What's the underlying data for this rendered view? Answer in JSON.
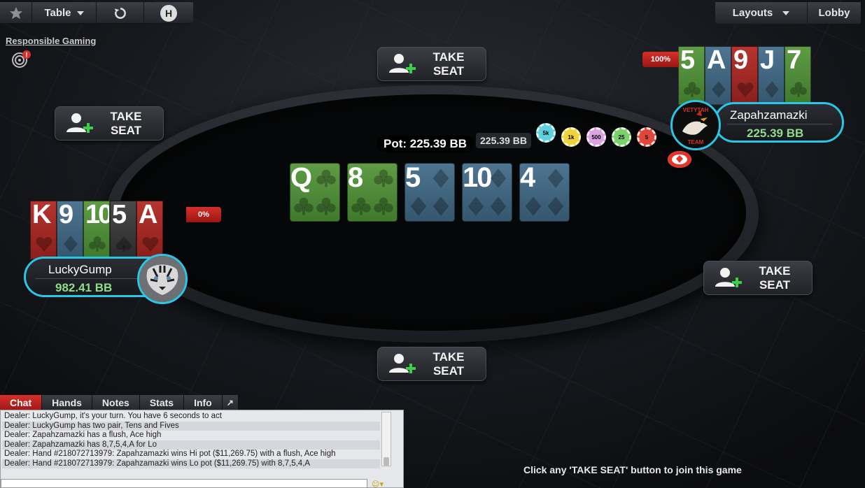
{
  "toolbar": {
    "table_label": "Table",
    "h_label": "H",
    "layouts_label": "Layouts",
    "lobby_label": "Lobby"
  },
  "responsible_gaming": "Responsible Gaming",
  "take_seat_label": "TAKE\nSEAT",
  "pot": "Pot: 225.39 BB",
  "bet_amount": "225.39 BB",
  "chips": [
    "5k",
    "1k",
    "500",
    "25",
    "5"
  ],
  "board": [
    {
      "rank": "Q",
      "suit": "clubs"
    },
    {
      "rank": "8",
      "suit": "clubs"
    },
    {
      "rank": "5",
      "suit": "diamonds"
    },
    {
      "rank": "10",
      "suit": "diamonds"
    },
    {
      "rank": "4",
      "suit": "diamonds"
    }
  ],
  "players": {
    "right": {
      "name": "Zapahzamazki",
      "stack": "225.39 BB",
      "percent": "100%",
      "avatar_text": "VETYTAH TEAM",
      "cards": [
        {
          "rank": "5",
          "suit": "clubs"
        },
        {
          "rank": "A",
          "suit": "diamonds"
        },
        {
          "rank": "9",
          "suit": "hearts"
        },
        {
          "rank": "J",
          "suit": "diamonds"
        },
        {
          "rank": "7",
          "suit": "clubs"
        }
      ]
    },
    "left": {
      "name": "LuckyGump",
      "stack": "982.41 BB",
      "percent": "0%",
      "cards": [
        {
          "rank": "K",
          "suit": "hearts"
        },
        {
          "rank": "9",
          "suit": "diamonds"
        },
        {
          "rank": "10",
          "suit": "clubs"
        },
        {
          "rank": "5",
          "suit": "spades"
        },
        {
          "rank": "A",
          "suit": "hearts"
        }
      ]
    }
  },
  "chat": {
    "tabs": [
      "Chat",
      "Hands",
      "Notes",
      "Stats",
      "Info"
    ],
    "popout": "↗",
    "lines": [
      "Dealer: LuckyGump, it's your turn. You have 6 seconds to act",
      "Dealer: LuckyGump has two pair, Tens and Fives",
      "Dealer: Zapahzamazki has a flush, Ace high",
      "Dealer: Zapahzamazki has 8,7,5,4,A for Lo",
      "Dealer: Hand #218072713979: Zapahzamazki wins Hi pot ($11,269.75) with a flush, Ace high",
      "Dealer: Hand #218072713979: Zapahzamazki wins Lo pot ($11,269.75) with 8,7,5,4,A"
    ]
  },
  "hint": "Click any 'TAKE SEAT' button to join this game",
  "colors": {
    "accent": "#2bc6e4",
    "clubs": "#4f8c39",
    "diamonds": "#41657f",
    "hearts": "#a2291f",
    "stack": "#8fdc8a",
    "alert": "#d6302a"
  }
}
